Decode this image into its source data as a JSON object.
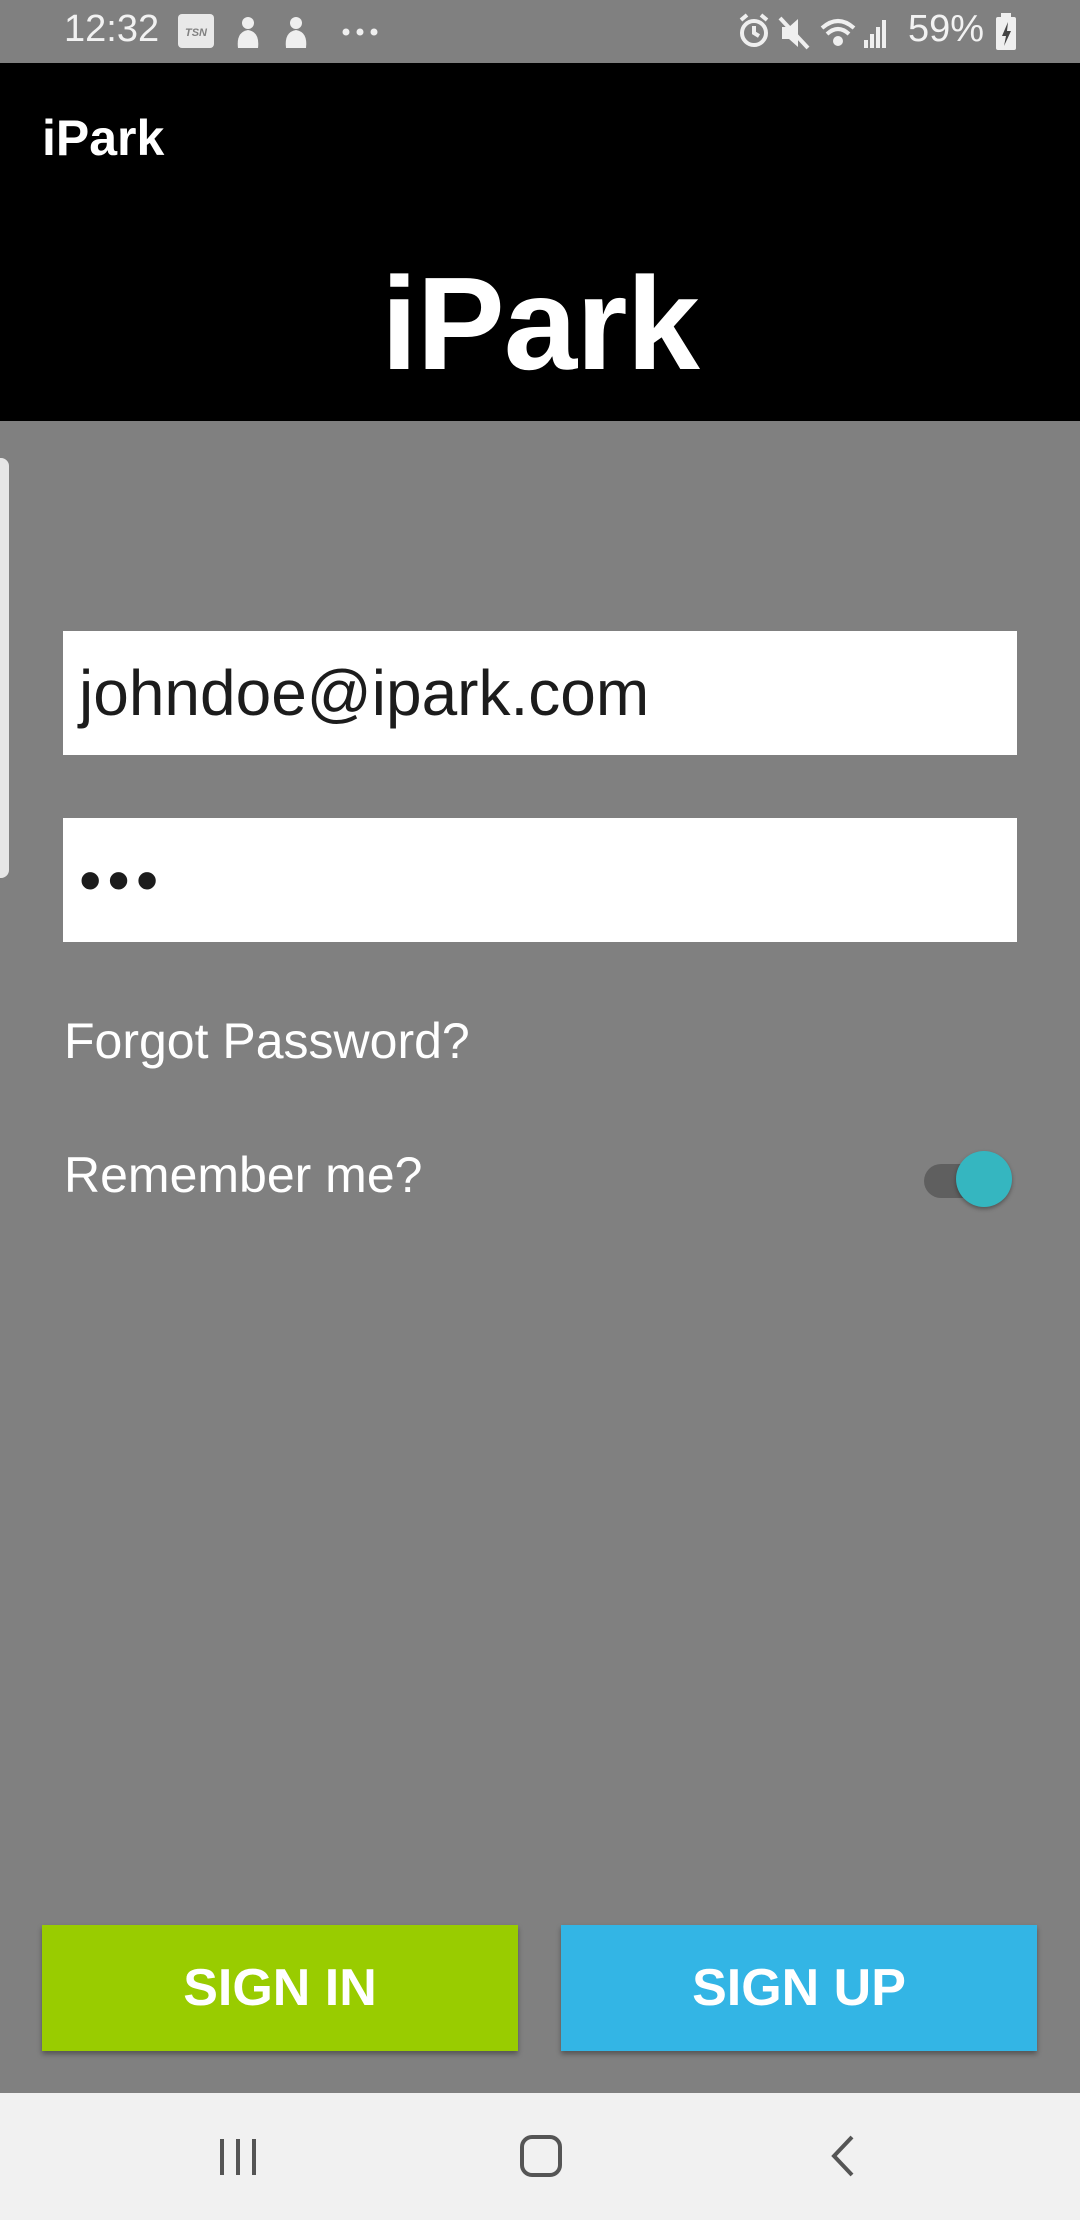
{
  "status_bar": {
    "time": "12:32",
    "left_icons": [
      "tsn-icon",
      "notification-icon",
      "notification-icon",
      "more-dots-icon"
    ],
    "right_icons": [
      "alarm-icon",
      "mute-icon",
      "wifi-icon",
      "signal-icon",
      "battery-icon"
    ],
    "battery_percent": "59%"
  },
  "app_bar": {
    "toolbar_title": "iPark",
    "hero_title": "iPark"
  },
  "form": {
    "email_value": "johndoe@ipark.com",
    "password_mask": "•••",
    "forgot_password": "Forgot Password?",
    "remember_me": "Remember me?",
    "remember_me_on": true
  },
  "buttons": {
    "sign_in": "SIGN IN",
    "sign_up": "SIGN UP"
  },
  "nav_bar": {
    "items": [
      "recents-icon",
      "home-icon",
      "back-icon"
    ]
  },
  "colors": {
    "background": "#808080",
    "app_bar": "#000000",
    "sign_in": "#99cc00",
    "sign_up": "#33b5e5",
    "switch_thumb": "#35b6c0"
  }
}
